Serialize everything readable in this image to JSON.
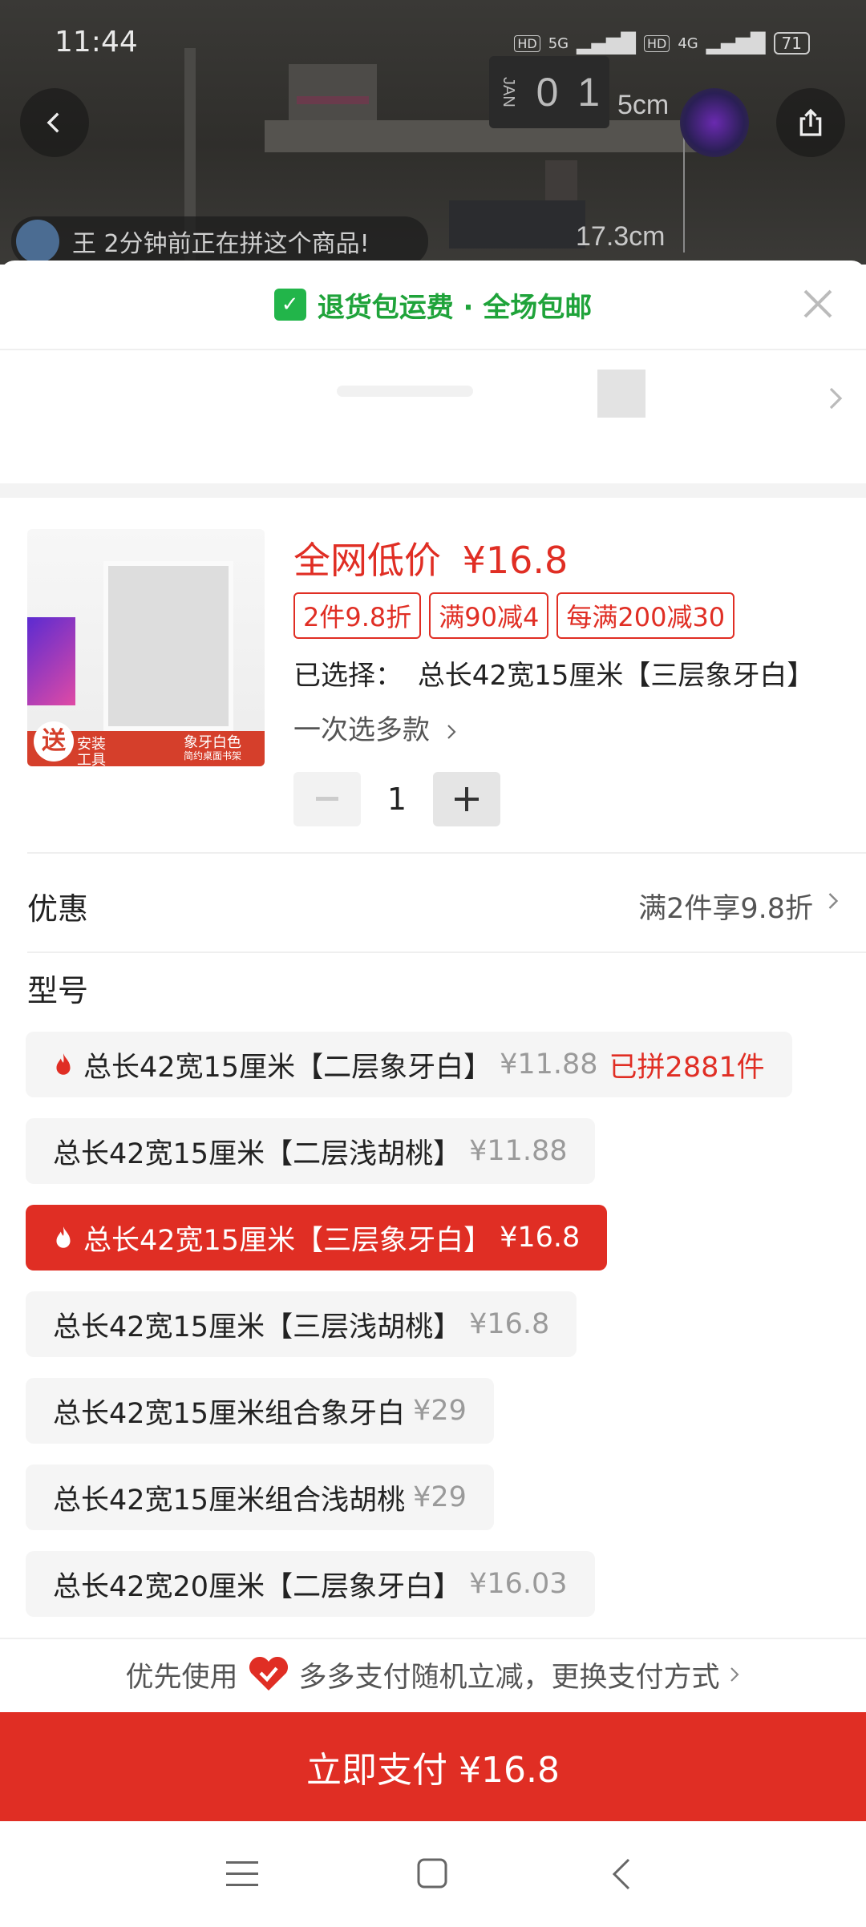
{
  "status": {
    "time": "11:44",
    "network_1": "5G",
    "network_2": "4G",
    "battery": "71"
  },
  "hero": {
    "calendar_month": "JAN",
    "calendar_d1": "0",
    "calendar_d2": "1",
    "dim_top": "5cm",
    "dim_side": "17.3cm",
    "ticker": "王 2分钟前正在拼这个商品!"
  },
  "banner": {
    "text": "退货包运费 · 全场包邮"
  },
  "product": {
    "price_label": "全网低价",
    "price": "¥16.8",
    "tags": [
      "2件9.8折",
      "满90减4",
      "每满200减30"
    ],
    "selected_label": "已选择：",
    "selected_value": "总长42宽15厘米【三层象牙白】",
    "multi_select": "一次选多款",
    "quantity": "1",
    "thumb_badge": "送",
    "thumb_badge_sub1": "安装",
    "thumb_badge_sub2": "工具",
    "thumb_color": "象牙白色",
    "thumb_sub": "简约桌面书架"
  },
  "discount": {
    "label": "优惠",
    "value": "满2件享9.8折"
  },
  "model": {
    "label": "型号",
    "options": [
      {
        "name": "总长42宽15厘米【二层象牙白】",
        "price": "¥11.88",
        "hot": "已拼2881件"
      },
      {
        "name": "总长42宽15厘米【二层浅胡桃】",
        "price": "¥11.88"
      },
      {
        "name": "总长42宽15厘米【三层象牙白】",
        "price": "¥16.8"
      },
      {
        "name": "总长42宽15厘米【三层浅胡桃】",
        "price": "¥16.8"
      },
      {
        "name": "总长42宽15厘米组合象牙白",
        "price": "¥29"
      },
      {
        "name": "总长42宽15厘米组合浅胡桃",
        "price": "¥29"
      },
      {
        "name": "总长42宽20厘米【二层象牙白】",
        "price": "¥16.03"
      }
    ]
  },
  "payment": {
    "prefix": "优先使用",
    "text": "多多支付随机立减，更换支付方式"
  },
  "pay_button": "立即支付 ¥16.8",
  "colors": {
    "accent": "#e02e24",
    "green": "#22b54a"
  }
}
